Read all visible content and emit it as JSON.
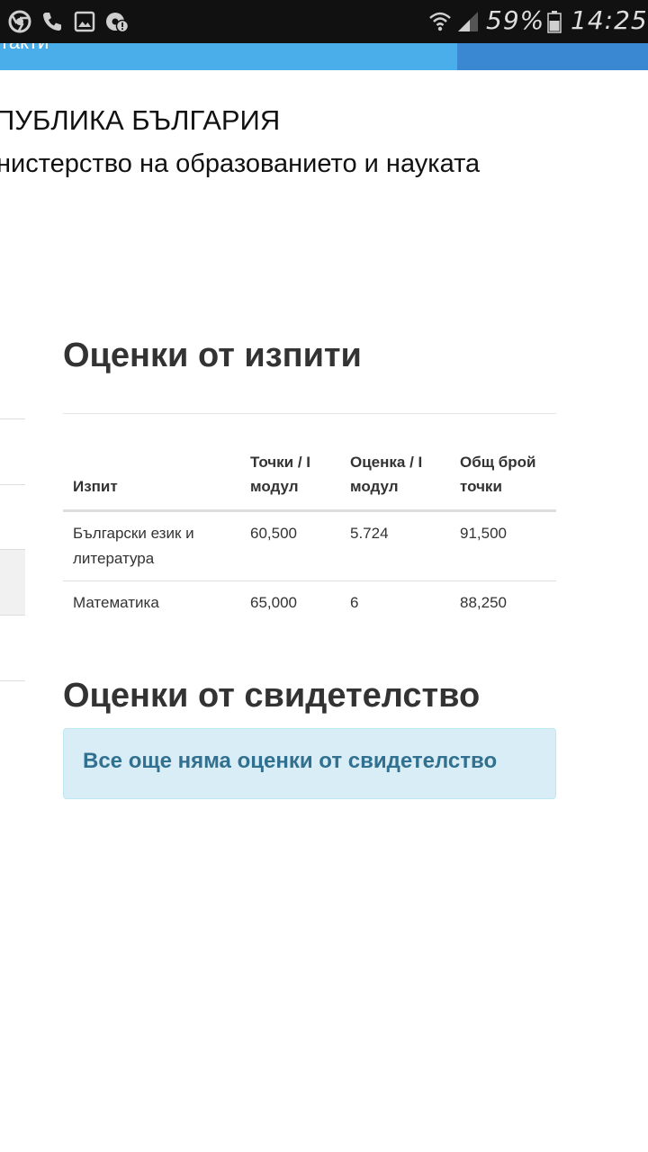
{
  "status_bar": {
    "icons_left": [
      "chrome-icon",
      "phone-icon",
      "image-icon",
      "chrome-alert-icon"
    ],
    "wifi_icon": "wifi-icon",
    "signal_icon": "signal-icon",
    "battery_percent": "59%",
    "battery_icon": "battery-icon",
    "time": "14:25"
  },
  "nav": {
    "link_partial": "такти"
  },
  "header": {
    "line1": "ПУБЛИКА БЪЛГАРИЯ",
    "line2": "нистерство на образованието и науката"
  },
  "exams": {
    "title": "Оценки от изпити",
    "columns": [
      "Изпит",
      "Точки / I модул",
      "Оценка / I модул",
      "Общ брой точки"
    ],
    "rows": [
      [
        "Български език и литература",
        "60,500",
        "5.724",
        "91,500"
      ],
      [
        "Математика",
        "65,000",
        "6",
        "88,250"
      ]
    ]
  },
  "certificate": {
    "title": "Оценки от свидетелство",
    "empty_message": "Все още няма оценки от свидетелство"
  },
  "colors": {
    "nav_blue": "#4aaeea",
    "nav_blue_dark": "#3a88d2",
    "alert_bg": "#d9edf7",
    "alert_text": "#31708f"
  }
}
